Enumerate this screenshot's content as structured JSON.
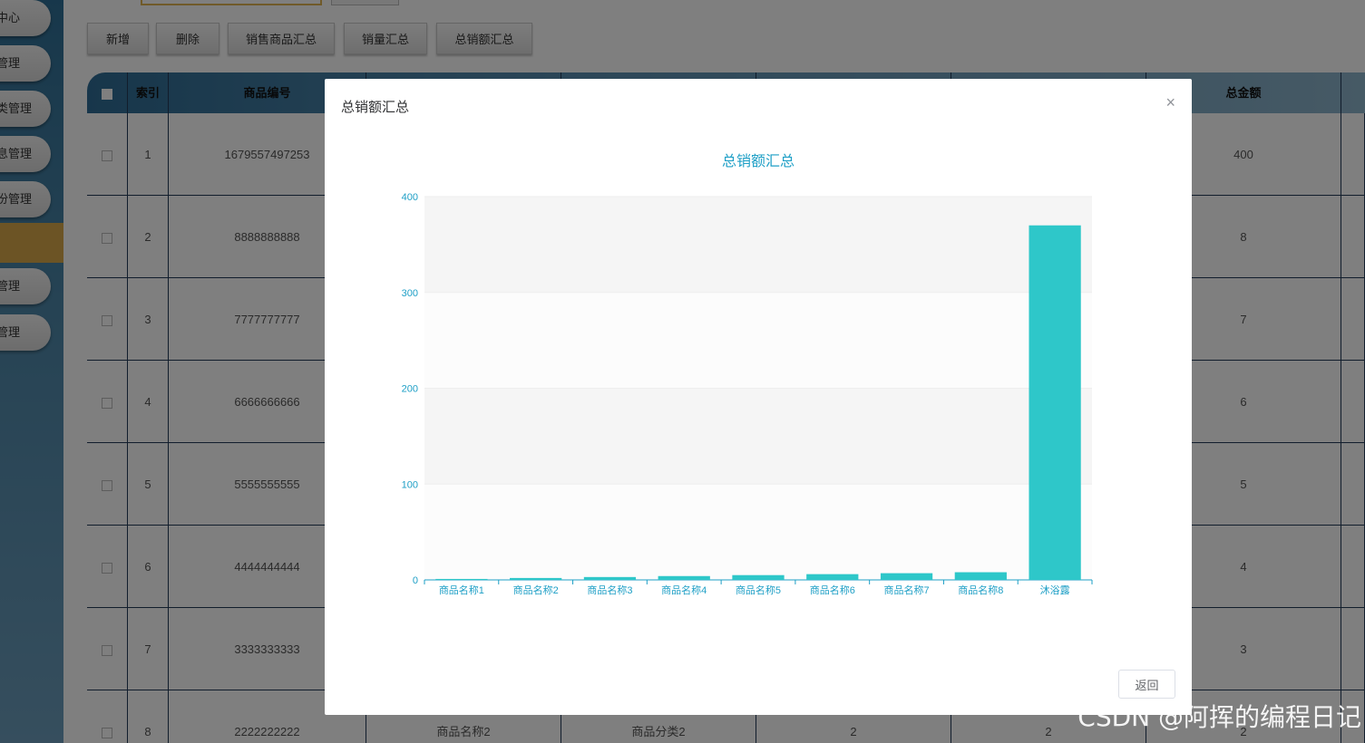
{
  "sidebar": {
    "items": [
      "中心",
      "管理",
      "类管理",
      "息管理",
      "份管理",
      "管理",
      "管理"
    ]
  },
  "toolbar": {
    "add_label": "新增",
    "delete_label": "删除",
    "sales_goods_label": "销售商品汇总",
    "sales_volume_label": "销量汇总",
    "total_amount_label": "总销额汇总"
  },
  "table": {
    "headers": {
      "index": "索引",
      "code": "商品编号",
      "total": "总金额"
    },
    "rows": [
      {
        "index": "1",
        "code": "1679557497253",
        "total": "400"
      },
      {
        "index": "2",
        "code": "8888888888",
        "total": "8"
      },
      {
        "index": "3",
        "code": "7777777777",
        "total": "7"
      },
      {
        "index": "4",
        "code": "6666666666",
        "total": "6"
      },
      {
        "index": "5",
        "code": "5555555555",
        "total": "5"
      },
      {
        "index": "6",
        "code": "4444444444",
        "total": "4"
      },
      {
        "index": "7",
        "code": "3333333333",
        "total": "3"
      },
      {
        "index": "8",
        "code": "2222222222",
        "name": "商品名称2",
        "category": "商品分类2",
        "price": "2",
        "qty": "2",
        "total": "2"
      }
    ]
  },
  "modal": {
    "title": "总销额汇总",
    "close": "×",
    "return_label": "返回"
  },
  "chart_data": {
    "type": "bar",
    "title": "总销额汇总",
    "categories": [
      "商品名称1",
      "商品名称2",
      "商品名称3",
      "商品名称4",
      "商品名称5",
      "商品名称6",
      "商品名称7",
      "商品名称8",
      "沐浴露"
    ],
    "values": [
      1,
      2,
      3,
      4,
      5,
      6,
      7,
      8,
      370
    ],
    "ylim": [
      0,
      400
    ],
    "yticks": [
      0,
      100,
      200,
      300,
      400
    ],
    "bar_color": "#2ec7c9",
    "axis_color": "#1e9fc6",
    "grid": true
  },
  "watermark": "CSDN @阿挥的编程日记"
}
